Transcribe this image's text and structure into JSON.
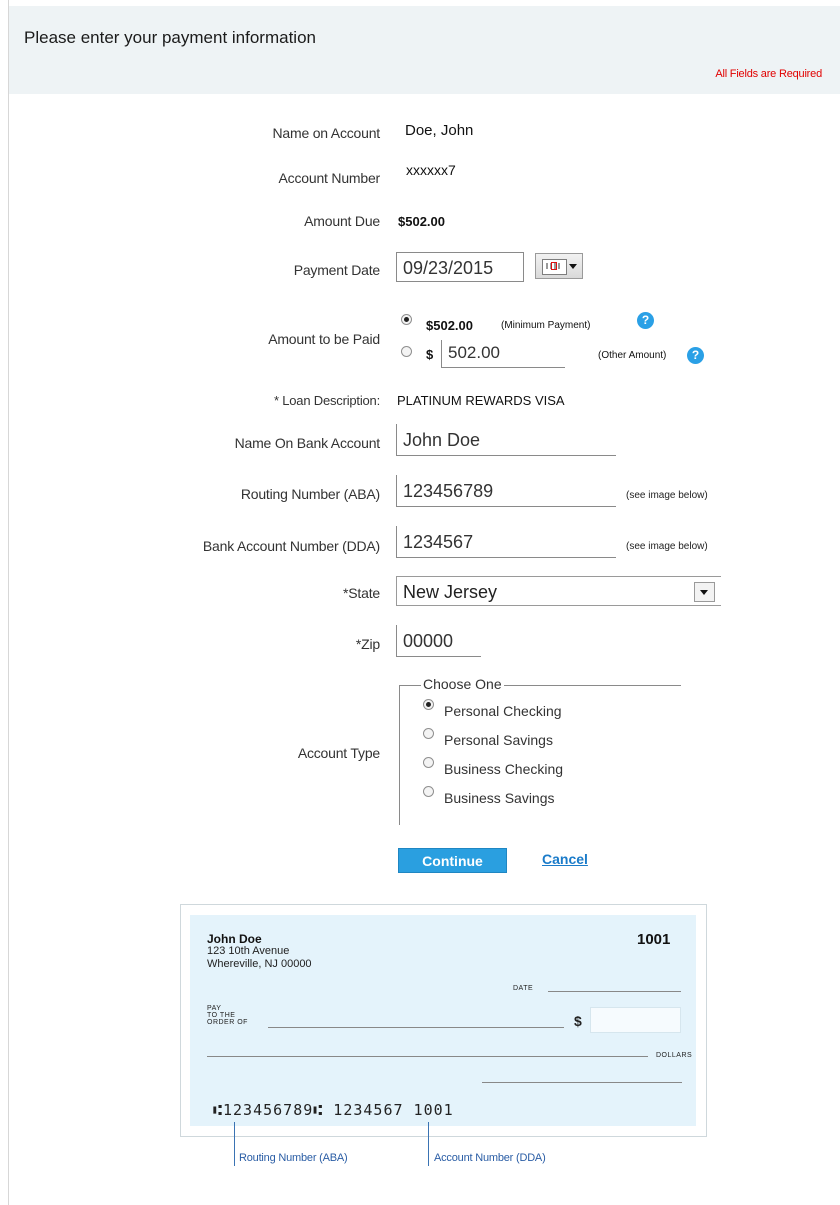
{
  "header": {
    "title": "Please enter your payment information",
    "required_note": "All Fields are Required"
  },
  "form": {
    "name_on_account": {
      "label": "Name on Account",
      "value": "Doe, John"
    },
    "account_number": {
      "label": "Account Number",
      "value": "xxxxxx7"
    },
    "amount_due": {
      "label": "Amount Due",
      "value": "$502.00"
    },
    "payment_date": {
      "label": "Payment Date",
      "value": "09/23/2015"
    },
    "amount_to_pay": {
      "label": "Amount to be Paid",
      "min_value": "$502.00",
      "min_note": "(Minimum Payment)",
      "currency": "$",
      "other_value": "502.00",
      "other_note": "(Other Amount)",
      "help_glyph": "?"
    },
    "loan_description": {
      "label": "* Loan Description:",
      "value": "PLATINUM REWARDS VISA"
    },
    "bank_account_name": {
      "label": "Name On Bank Account",
      "value": "John Doe"
    },
    "routing_number": {
      "label": "Routing Number (ABA)",
      "value": "123456789",
      "note": "(see image below)"
    },
    "bank_account_number": {
      "label": "Bank Account Number (DDA)",
      "value": "1234567",
      "note": "(see image below)"
    },
    "state": {
      "label": "*State",
      "value": "New Jersey"
    },
    "zip": {
      "label": "*Zip",
      "value": "00000"
    },
    "account_type": {
      "label": "Account Type",
      "legend": "Choose One",
      "options": [
        "Personal Checking",
        "Personal Savings",
        "Business Checking",
        "Business Savings"
      ],
      "selected": "Personal Checking"
    }
  },
  "actions": {
    "continue_label": "Continue",
    "cancel_label": "Cancel"
  },
  "check_image": {
    "name": "John Doe",
    "address_line1": "123 10th Avenue",
    "address_line2": "Whereville, NJ 00000",
    "check_number": "1001",
    "date_label": "DATE",
    "pay_line1": "PAY",
    "pay_line2": "TO THE",
    "pay_line3": "ORDER OF",
    "dollar_sign": "$",
    "dollars_label": "DOLLARS",
    "micr_line": "⑆123456789⑆ 1234567 1001",
    "routing_caption": "Routing Number (ABA)",
    "account_caption": "Account Number (DDA)"
  },
  "colors": {
    "header_bg": "#eef3f5",
    "required_red": "#e10000",
    "accent_blue": "#2a9fe0",
    "check_bg": "#e4f3fb"
  }
}
